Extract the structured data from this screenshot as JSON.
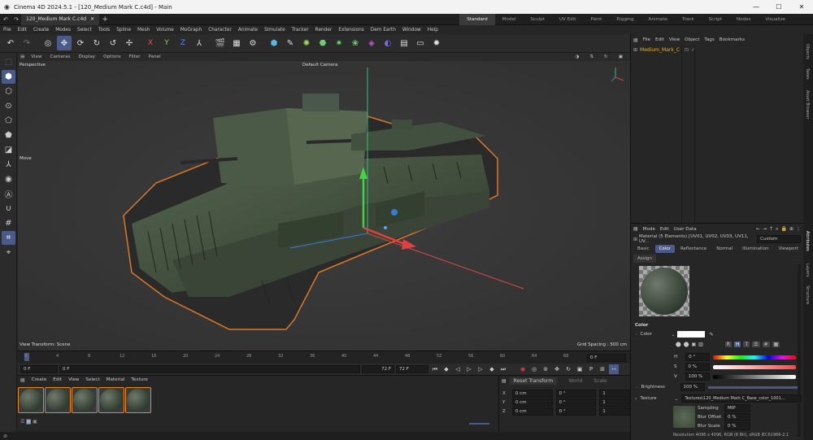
{
  "window": {
    "title": "Cinema 4D 2024.5.1 - [120_Medium Mark C.c4d] - Main"
  },
  "document_tab": "120_Medium Mark C.c4d",
  "layouts": [
    "Standard",
    "Model",
    "Sculpt",
    "UV Edit",
    "Paint",
    "Rigging",
    "Animate",
    "Track",
    "Script",
    "Nodes",
    "Visualize"
  ],
  "menu": [
    "File",
    "Edit",
    "Create",
    "Modes",
    "Select",
    "Tools",
    "Spline",
    "Mesh",
    "Volume",
    "MoGraph",
    "Character",
    "Animate",
    "Simulate",
    "Tracker",
    "Render",
    "Extensions",
    "Dem Earth",
    "Window",
    "Help"
  ],
  "toolbar": {
    "axis_x": "X",
    "axis_y": "Y",
    "axis_z": "Z"
  },
  "viewport": {
    "menu": [
      "View",
      "Cameras",
      "Display",
      "Options",
      "Filter",
      "Panel"
    ],
    "name": "Perspective",
    "camera": "Default Camera",
    "tool_label": "Move",
    "view_transform": "View Transform: Scene",
    "grid_spacing": "Grid Spacing : 500 cm"
  },
  "timeline": {
    "ticks": [
      "0",
      "4",
      "8",
      "12",
      "16",
      "20",
      "24",
      "28",
      "32",
      "36",
      "40",
      "44",
      "48",
      "52",
      "56",
      "60",
      "64",
      "68",
      "72"
    ],
    "current": "0 F"
  },
  "transport": {
    "start": "0 F",
    "start2": "0 F",
    "end": "72 F",
    "end2": "72 F"
  },
  "material_manager": {
    "menu": [
      "Create",
      "Edit",
      "View",
      "Select",
      "Material",
      "Texture"
    ],
    "count": 5
  },
  "coordinates": {
    "reset": "Reset Transform",
    "world": "World",
    "scale": "Scale",
    "rows": [
      {
        "axis": "X",
        "pos": "0 cm",
        "rot": "0 °",
        "scale": "1"
      },
      {
        "axis": "Y",
        "pos": "0 cm",
        "rot": "0 °",
        "scale": "1"
      },
      {
        "axis": "Z",
        "pos": "0 cm",
        "rot": "0 °",
        "scale": "1"
      }
    ]
  },
  "objects_panel": {
    "menu": [
      "File",
      "Edit",
      "View",
      "Object",
      "Tags",
      "Bookmarks"
    ],
    "item": "Medium_Mark_C"
  },
  "attributes": {
    "menu": [
      "Mode",
      "Edit",
      "User Data"
    ],
    "material_line": "Material (5 Elements) [UV01, UV02, UV03, UV11, UV...",
    "custom": "Custom",
    "tabs": [
      "Basic",
      "Color",
      "Reflectance",
      "Normal",
      "Illumination",
      "Viewport"
    ],
    "assign": "Assign",
    "section": "Color",
    "color_label": "Color",
    "h_label": "H",
    "h_val": "0 °",
    "s_label": "S",
    "s_val": "0 %",
    "v_label": "V",
    "v_val": "100 %",
    "brightness_label": "Brightness",
    "brightness_val": "100 %",
    "texture_label": "Texture",
    "texture_file": "Textures\\120_Medium Mark C_Base_color_1001...",
    "sampling_label": "Sampling",
    "sampling_val": "MIP",
    "blur_offset_label": "Blur Offset",
    "blur_offset_val": "0 %",
    "blur_scale_label": "Blur Scale",
    "blur_scale_val": "0 %",
    "resolution": "Resolution 4096 x 4096, RGB (8 Bit), sRGB IEC61966-2.1"
  },
  "right_tabs": [
    "Objects",
    "Takes",
    "Asset Browser",
    "Attributes",
    "Layers",
    "Structure"
  ],
  "colors": {
    "accent": "#4a5b8a",
    "selection": "#e28a2a",
    "tank": "#3e4a3c"
  }
}
